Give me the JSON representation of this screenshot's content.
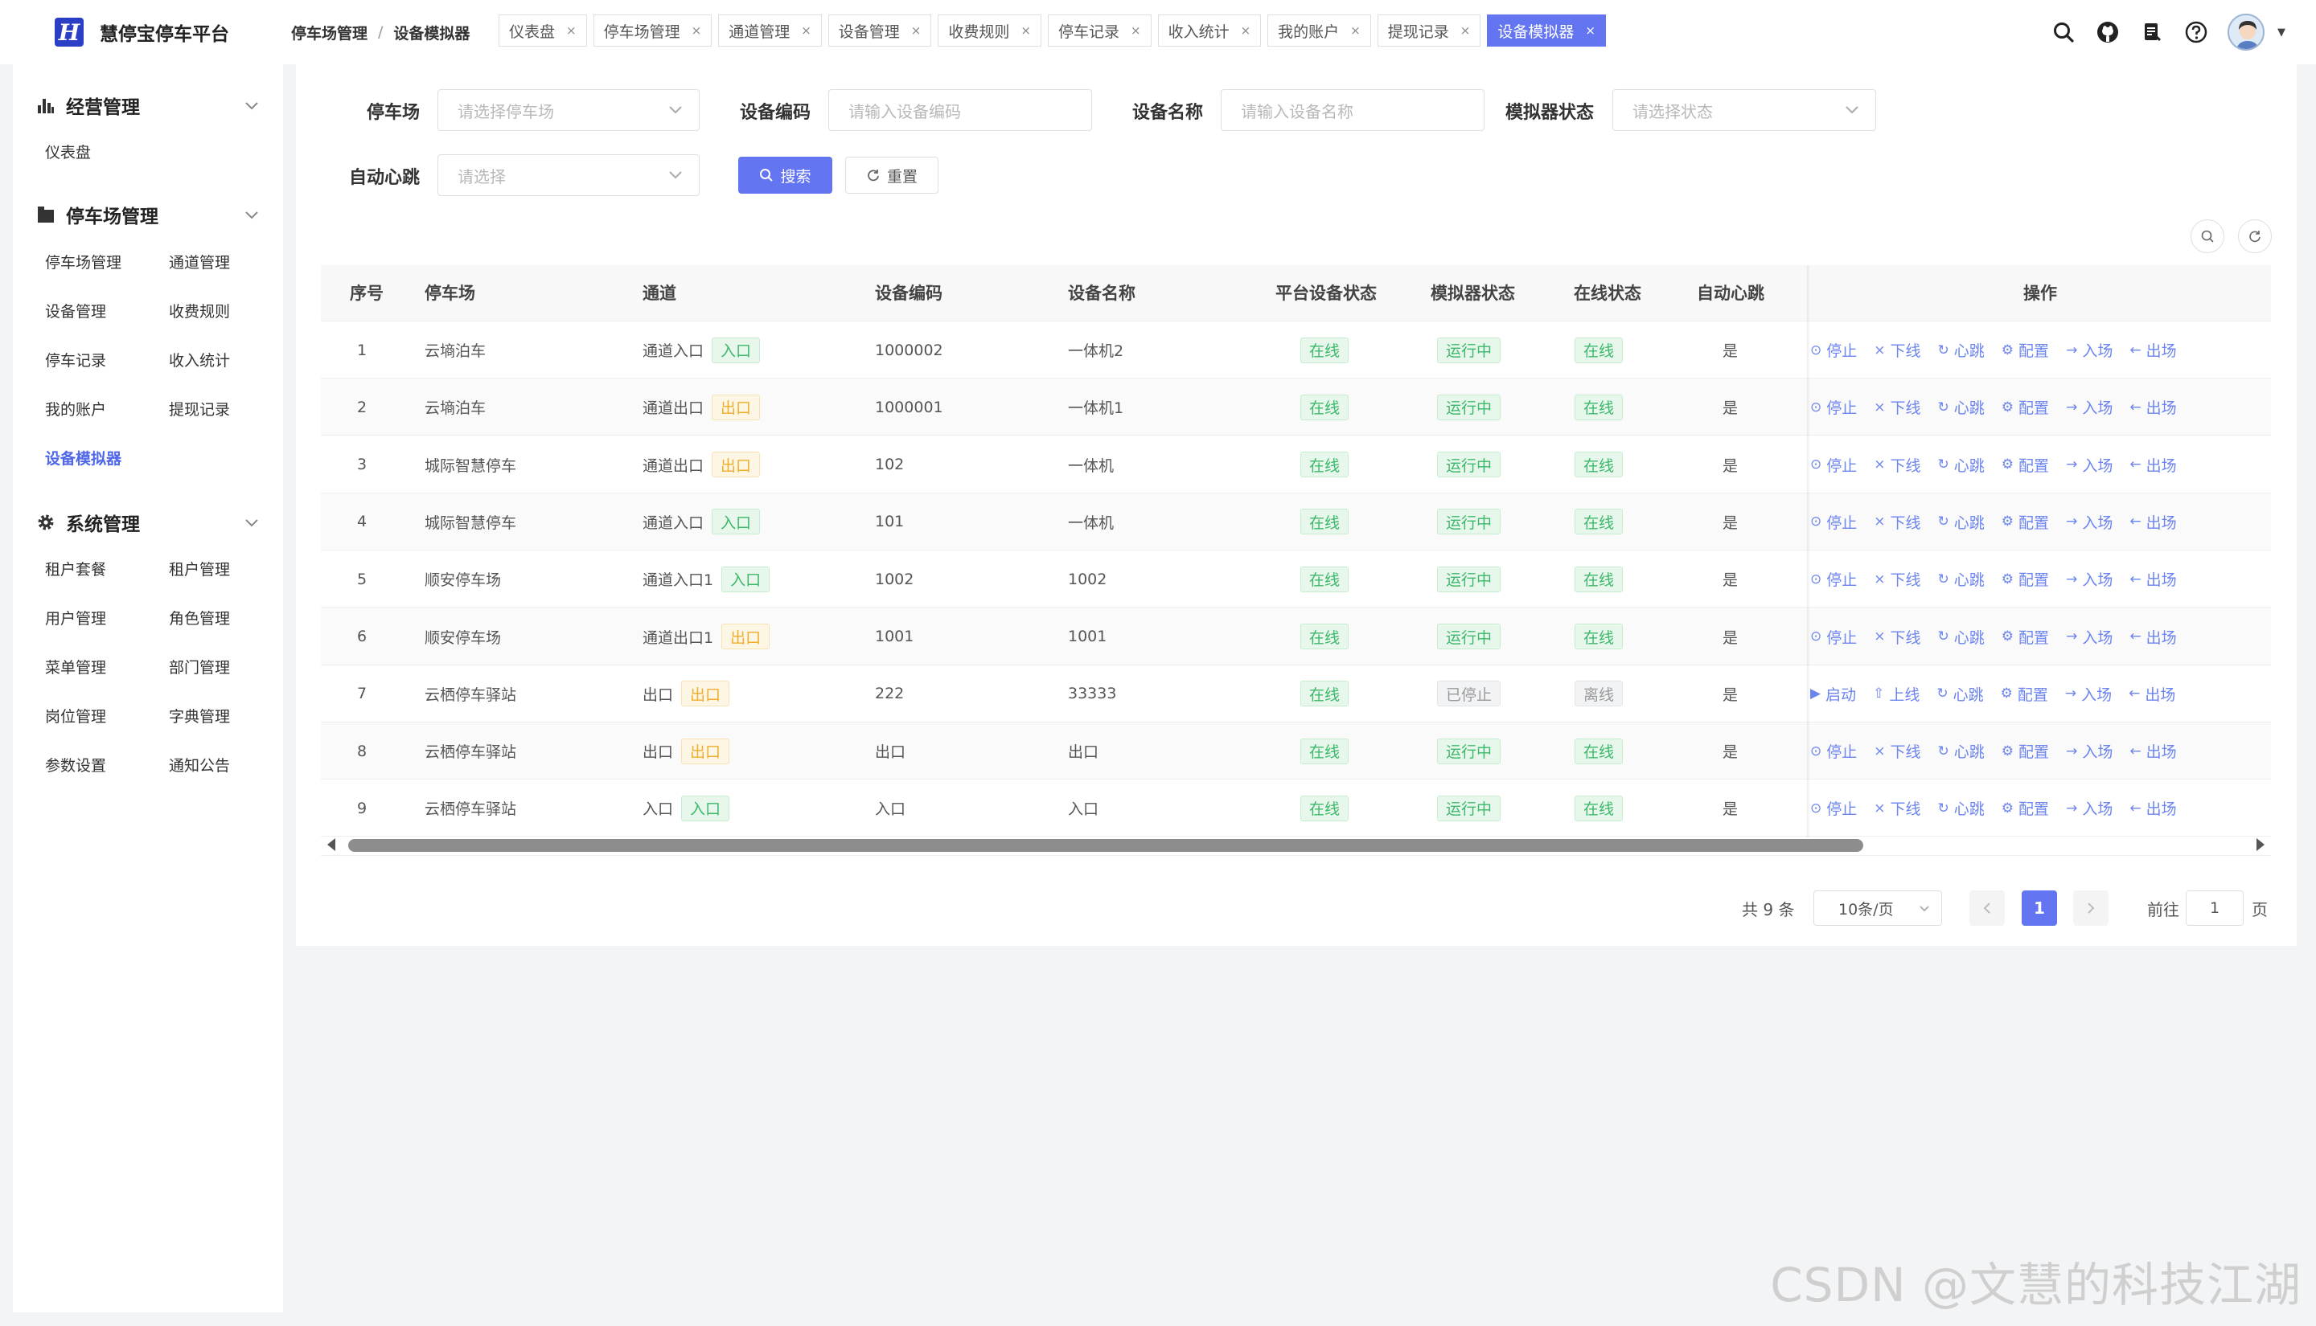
{
  "app": {
    "title": "慧停宝停车平台",
    "logo_letter": "H"
  },
  "breadcrumb": [
    "停车场管理",
    "设备模拟器"
  ],
  "tabs": [
    {
      "label": "仪表盘",
      "active": false
    },
    {
      "label": "停车场管理",
      "active": false
    },
    {
      "label": "通道管理",
      "active": false
    },
    {
      "label": "设备管理",
      "active": false
    },
    {
      "label": "收费规则",
      "active": false
    },
    {
      "label": "停车记录",
      "active": false
    },
    {
      "label": "收入统计",
      "active": false
    },
    {
      "label": "我的账户",
      "active": false
    },
    {
      "label": "提现记录",
      "active": false
    },
    {
      "label": "设备模拟器",
      "active": true
    }
  ],
  "header_icons": [
    "search-icon",
    "github-icon",
    "document-icon",
    "help-icon"
  ],
  "sidebar": {
    "groups": [
      {
        "label": "经营管理",
        "icon": "bar-chart-icon",
        "items": [
          "仪表盘"
        ]
      },
      {
        "label": "停车场管理",
        "icon": "parking-icon",
        "items": [
          "停车场管理",
          "通道管理",
          "设备管理",
          "收费规则",
          "停车记录",
          "收入统计",
          "我的账户",
          "提现记录",
          "设备模拟器"
        ]
      },
      {
        "label": "系统管理",
        "icon": "gear-icon",
        "items": [
          "租户套餐",
          "租户管理",
          "用户管理",
          "角色管理",
          "菜单管理",
          "部门管理",
          "岗位管理",
          "字典管理",
          "参数设置",
          "通知公告"
        ]
      }
    ],
    "active_item": "设备模拟器"
  },
  "filters": {
    "parking": {
      "label": "停车场",
      "placeholder": "请选择停车场"
    },
    "device_code": {
      "label": "设备编码",
      "placeholder": "请输入设备编码"
    },
    "device_name": {
      "label": "设备名称",
      "placeholder": "请输入设备名称"
    },
    "sim_status": {
      "label": "模拟器状态",
      "placeholder": "请选择状态"
    },
    "auto_heartbeat": {
      "label": "自动心跳",
      "placeholder": "请选择"
    },
    "search_label": "搜索",
    "reset_label": "重置"
  },
  "table": {
    "columns": [
      "序号",
      "停车场",
      "通道",
      "设备编码",
      "设备名称",
      "平台设备状态",
      "模拟器状态",
      "在线状态",
      "自动心跳",
      "操作"
    ],
    "rows": [
      {
        "no": "1",
        "lot": "云墒泊车",
        "channel": "通道入口",
        "dir": "入口",
        "code": "1000002",
        "name": "一体机2",
        "platform": "在线",
        "sim": "运行中",
        "online": "在线",
        "hb": "是",
        "running": true
      },
      {
        "no": "2",
        "lot": "云墒泊车",
        "channel": "通道出口",
        "dir": "出口",
        "code": "1000001",
        "name": "一体机1",
        "platform": "在线",
        "sim": "运行中",
        "online": "在线",
        "hb": "是",
        "running": true
      },
      {
        "no": "3",
        "lot": "城际智慧停车",
        "channel": "通道出口",
        "dir": "出口",
        "code": "102",
        "name": "一体机",
        "platform": "在线",
        "sim": "运行中",
        "online": "在线",
        "hb": "是",
        "running": true
      },
      {
        "no": "4",
        "lot": "城际智慧停车",
        "channel": "通道入口",
        "dir": "入口",
        "code": "101",
        "name": "一体机",
        "platform": "在线",
        "sim": "运行中",
        "online": "在线",
        "hb": "是",
        "running": true
      },
      {
        "no": "5",
        "lot": "顺安停车场",
        "channel": "通道入口1",
        "dir": "入口",
        "code": "1002",
        "name": "1002",
        "platform": "在线",
        "sim": "运行中",
        "online": "在线",
        "hb": "是",
        "running": true
      },
      {
        "no": "6",
        "lot": "顺安停车场",
        "channel": "通道出口1",
        "dir": "出口",
        "code": "1001",
        "name": "1001",
        "platform": "在线",
        "sim": "运行中",
        "online": "在线",
        "hb": "是",
        "running": true
      },
      {
        "no": "7",
        "lot": "云栖停车驿站",
        "channel": "出口",
        "dir": "出口",
        "code": "222",
        "name": "33333",
        "platform": "在线",
        "sim": "已停止",
        "online": "离线",
        "hb": "是",
        "running": false
      },
      {
        "no": "8",
        "lot": "云栖停车驿站",
        "channel": "出口",
        "dir": "出口",
        "code": "出口",
        "name": "出口",
        "platform": "在线",
        "sim": "运行中",
        "online": "在线",
        "hb": "是",
        "running": true
      },
      {
        "no": "9",
        "lot": "云栖停车驿站",
        "channel": "入口",
        "dir": "入口",
        "code": "入口",
        "name": "入口",
        "platform": "在线",
        "sim": "运行中",
        "online": "在线",
        "hb": "是",
        "running": true
      }
    ],
    "actions_running": [
      "停止",
      "下线",
      "心跳",
      "配置",
      "入场",
      "出场"
    ],
    "actions_stopped": [
      "启动",
      "上线",
      "心跳",
      "配置",
      "入场",
      "出场"
    ]
  },
  "pagination": {
    "total_text": "共 9 条",
    "page_size": "10条/页",
    "current_page": "1",
    "goto_label": "前往",
    "goto_value": "1",
    "page_unit": "页"
  },
  "watermark": "CSDN @文慧的科技江湖",
  "colors": {
    "primary": "#6375f0",
    "success": "#3cb86a",
    "warning": "#f0ad2b",
    "link": "#6c84ee"
  }
}
